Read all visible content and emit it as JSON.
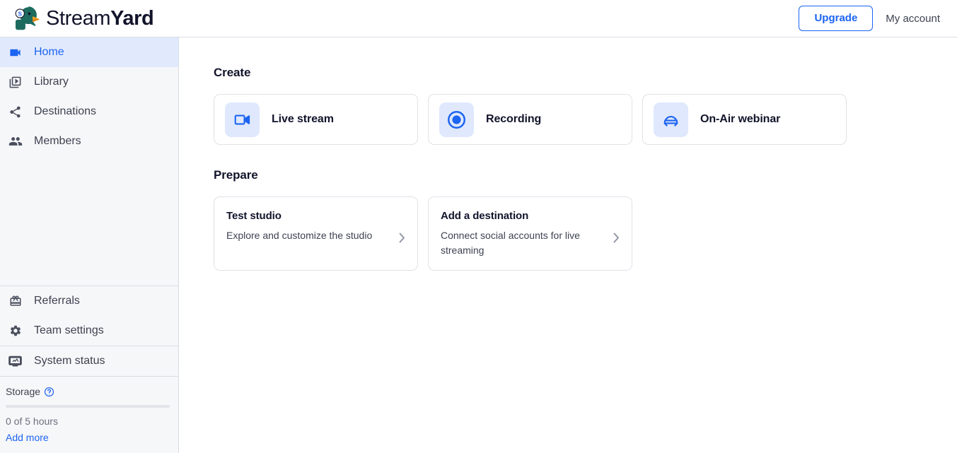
{
  "header": {
    "brand_name_light": "Stream",
    "brand_name_bold": "Yard",
    "logo_icon": "duck-head-logo",
    "upgrade_label": "Upgrade",
    "account_label": "My account"
  },
  "sidebar": {
    "primary_items": [
      {
        "label": "Home",
        "icon": "video-camera-icon",
        "active": true
      },
      {
        "label": "Library",
        "icon": "video-library-icon",
        "active": false
      },
      {
        "label": "Destinations",
        "icon": "share-icon",
        "active": false
      },
      {
        "label": "Members",
        "icon": "people-group-icon",
        "active": false
      }
    ],
    "secondary_items": [
      {
        "label": "Referrals",
        "icon": "gift-icon"
      },
      {
        "label": "Team settings",
        "icon": "gear-icon"
      }
    ],
    "status_items": [
      {
        "label": "System status",
        "icon": "monitor-chart-icon"
      }
    ],
    "storage": {
      "label": "Storage",
      "help_icon": "question-circle-icon",
      "used_text": "0 of 5 hours",
      "percent": 0,
      "add_more_label": "Add more"
    }
  },
  "main": {
    "create": {
      "title": "Create",
      "cards": [
        {
          "label": "Live stream",
          "icon": "video-camera-icon"
        },
        {
          "label": "Recording",
          "icon": "record-circle-icon"
        },
        {
          "label": "On-Air webinar",
          "icon": "on-air-broadcast-icon"
        }
      ]
    },
    "prepare": {
      "title": "Prepare",
      "cards": [
        {
          "title": "Test studio",
          "description": "Explore and customize the studio",
          "chevron_icon": "chevron-right-icon"
        },
        {
          "title": "Add a destination",
          "description": "Connect social accounts for live streaming",
          "chevron_icon": "chevron-right-icon"
        }
      ]
    }
  },
  "colors": {
    "accent_blue": "#1c64f2",
    "active_nav_bg": "#e1eafd",
    "icon_tile_bg": "#dfe8fd",
    "sidebar_bg": "#f6f7f9",
    "border": "#d9dce3",
    "text_dark": "#12142b",
    "text_muted": "#6a707e",
    "logo_green": "#1d6b5f"
  }
}
